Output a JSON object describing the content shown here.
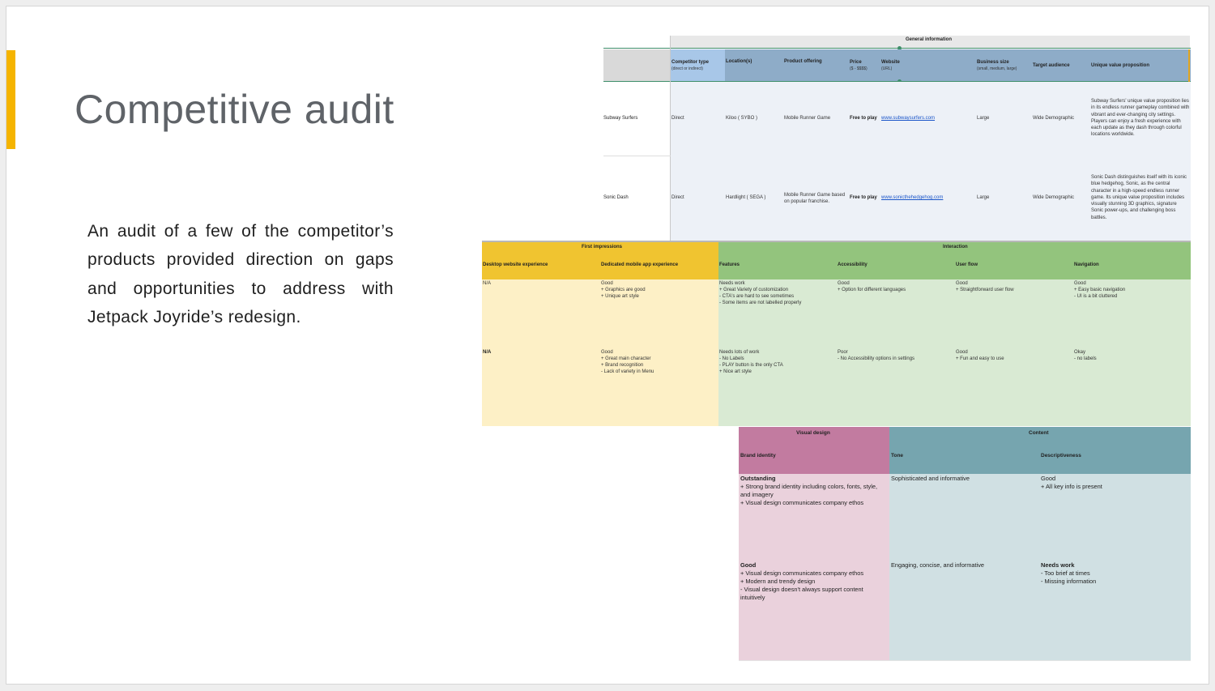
{
  "slide": {
    "title": "Competitive audit",
    "description": "An audit of a few of the competitor’s products provided direction on gaps and opportunities to address with Jetpack Joyride’s redesign."
  },
  "general": {
    "group": "General information",
    "headers": {
      "competitor_type": "Competitor type",
      "competitor_type_sub": "(direct or indirect)",
      "location": "Location(s)",
      "product_offering": "Product offering",
      "price": "Price",
      "price_sub": "($ - $$$$)",
      "website": "Website",
      "website_sub": "(URL)",
      "business_size": "Business size",
      "business_size_sub": "(small, medium, large)",
      "target_audience": "Target audience",
      "uvp": "Unique value proposition"
    },
    "rows": [
      {
        "name": "Subway Surfers",
        "type": "Direct",
        "location": "Kiloo ( SYBO )",
        "product": "Mobile Runner Game",
        "price": "Free to play",
        "website": "www.subwaysurfers.com",
        "size": "Large",
        "audience": "Wide Demographic",
        "uvp": "Subway Surfers' unique value proposition lies in its endless runner gameplay combined with vibrant and ever-changing city settings. Players can enjoy a fresh experience with each update as they dash through colorful locations worldwide."
      },
      {
        "name": "Sonic Dash",
        "type": "Direct",
        "location": "Hardlight ( SEGA )",
        "product": "Mobile Runner Game based on popular franchise.",
        "price": "Free to play",
        "website": "www.sonicthehedgehog.com",
        "size": "Large",
        "audience": "Wide Demographic",
        "uvp": "Sonic Dash distinguishes itself with its iconic blue hedgehog, Sonic, as the central character in a high-speed endless runner game. Its unique value proposition includes visually stunning 3D graphics, signature Sonic power-ups, and challenging boss battles."
      }
    ]
  },
  "impressions": {
    "first_group": "First impressions",
    "interaction_group": "Interaction",
    "headers": {
      "desktop": "Desktop website experience",
      "mobile": "Dedicated mobile app experience",
      "features": "Features",
      "accessibility": "Accessibility",
      "user_flow": "User flow",
      "navigation": "Navigation"
    },
    "rows": [
      {
        "desktop": "N/A",
        "mobile": "Good\n+ Graphics are good\n+ Unique art style",
        "features": "Needs work\n+ Great Variety of customization\n- CTA's are hard to see sometimes\n- Some items are not labelled properly",
        "accessibility": "Good\n+ Option for different languages",
        "user_flow": "Good\n+ Straightforward user flow",
        "navigation": "Good\n+ Easy basic navigation\n- UI is a bit cluttered"
      },
      {
        "desktop": "N/A",
        "mobile": "Good\n+ Great main character\n+ Brand recognition\n- Lack of variety in Menu",
        "features": "Needs lots of work\n- No Labels\n- PLAY button is the only CTA\n+ Nice art style",
        "accessibility": "Poor\n- No Accessibility options in settings",
        "user_flow": "Good\n+ Fun and easy to use",
        "navigation": "Okay\n- no labels"
      }
    ]
  },
  "design": {
    "visual_group": "Visual design",
    "content_group": "Content",
    "headers": {
      "brand": "Brand identity",
      "tone": "Tone",
      "descriptiveness": "Descriptiveness"
    },
    "rows": [
      {
        "brand_head": "Outstanding",
        "brand_body": "+ Strong brand identity including colors, fonts, style, and imagery\n+ Visual design communicates company ethos",
        "tone": "Sophisticated and informative",
        "desc_head": "Good",
        "desc_body": "+ All key info is present"
      },
      {
        "brand_head": "Good",
        "brand_body": "+ Visual design communicates company ethos\n+ Modern and trendy design\n- Visual design doesn't always support content intuitively",
        "tone": "Engaging, concise, and informative",
        "desc_head": "Needs work",
        "desc_body": "- Too brief at times\n- Missing information"
      }
    ]
  },
  "colors": {
    "accent": "#f5b400",
    "general_header": "#8eacc8",
    "general_body": "#edf1f7",
    "first_header": "#f0c430",
    "first_body": "#fdf0c6",
    "interaction_header": "#93c47d",
    "interaction_body": "#d9ead3",
    "visual_header": "#c27ba0",
    "visual_body": "#ead1dc",
    "content_header": "#76a5af",
    "content_body": "#d0e0e3"
  }
}
